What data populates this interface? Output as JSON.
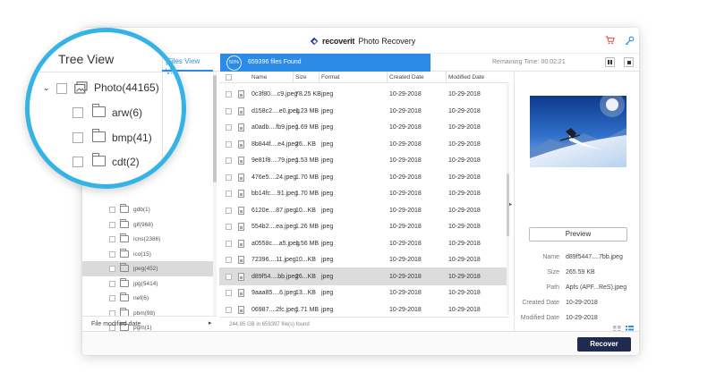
{
  "app": {
    "brand": "recoverit",
    "title": "Photo Recovery",
    "colors": {
      "accent": "#2b8be6",
      "ring": "#34b4e6",
      "recover_bg": "#1e2b4f"
    }
  },
  "toolbar": {
    "files_view_tab": "Files View",
    "progress_percent": "50%",
    "files_found": "659396 files Found",
    "remaining_time": "Remaining Time: 00:02:21"
  },
  "tree": {
    "title": "Tree View",
    "root": {
      "label": "Photo(44165)"
    },
    "magnified_items": [
      {
        "label": "arw(6)"
      },
      {
        "label": "bmp(41)"
      },
      {
        "label": "cdt(2)"
      }
    ],
    "items": [
      {
        "label": "gdb(1)",
        "selected": false
      },
      {
        "label": "gif(968)",
        "selected": false
      },
      {
        "label": "icns(2386)",
        "selected": false
      },
      {
        "label": "ico(15)",
        "selected": false
      },
      {
        "label": "jpeg(452)",
        "selected": true
      },
      {
        "label": "jpg(5414)",
        "selected": false
      },
      {
        "label": "nef(6)",
        "selected": false
      },
      {
        "label": "pbm(98)",
        "selected": false
      },
      {
        "label": "pgm(1)",
        "selected": false
      }
    ],
    "footer": "File modified date"
  },
  "table": {
    "columns": [
      "Name",
      "Size",
      "Format",
      "Created Date",
      "Modified Date"
    ],
    "rows": [
      {
        "name": "0c3f80....c9.jpeg",
        "size": "78.25 KB",
        "format": "jpeg",
        "created": "10-29-2018",
        "modified": "10-29-2018",
        "selected": false
      },
      {
        "name": "d158c2....e0.jpeg",
        "size": "1.23 MB",
        "format": "jpeg",
        "created": "10-29-2018",
        "modified": "10-29-2018",
        "selected": false
      },
      {
        "name": "a0adb....fb9.jpeg",
        "size": "1.69 MB",
        "format": "jpeg",
        "created": "10-29-2018",
        "modified": "10-29-2018",
        "selected": false
      },
      {
        "name": "8b844f....e4.jpeg",
        "size": "26...KB",
        "format": "jpeg",
        "created": "10-29-2018",
        "modified": "10-29-2018",
        "selected": false
      },
      {
        "name": "9e81f8....79.jpeg",
        "size": "1.53 MB",
        "format": "jpeg",
        "created": "10-29-2018",
        "modified": "10-29-2018",
        "selected": false
      },
      {
        "name": "476e5....24.jpeg",
        "size": "1.70 MB",
        "format": "jpeg",
        "created": "10-29-2018",
        "modified": "10-29-2018",
        "selected": false
      },
      {
        "name": "bb14fc....91.jpeg",
        "size": "1.70 MB",
        "format": "jpeg",
        "created": "10-29-2018",
        "modified": "10-29-2018",
        "selected": false
      },
      {
        "name": "6120e....87.jpeg",
        "size": "10...KB",
        "format": "jpeg",
        "created": "10-29-2018",
        "modified": "10-29-2018",
        "selected": false
      },
      {
        "name": "554b2....ea.jpeg",
        "size": "1.26 MB",
        "format": "jpeg",
        "created": "10-29-2018",
        "modified": "10-29-2018",
        "selected": false
      },
      {
        "name": "a0558c....a5.jpeg",
        "size": "1.56 MB",
        "format": "jpeg",
        "created": "10-29-2018",
        "modified": "10-29-2018",
        "selected": false
      },
      {
        "name": "72396....11.jpeg",
        "size": "10...KB",
        "format": "jpeg",
        "created": "10-29-2018",
        "modified": "10-29-2018",
        "selected": false
      },
      {
        "name": "d89f54....bb.jpeg",
        "size": "26...KB",
        "format": "jpeg",
        "created": "10-29-2018",
        "modified": "10-29-2018",
        "selected": true
      },
      {
        "name": "9aaa85....6.jpeg",
        "size": "13...KB",
        "format": "jpeg",
        "created": "10-29-2018",
        "modified": "10-29-2018",
        "selected": false
      },
      {
        "name": "06987....2fc.jpeg",
        "size": "1.71 MB",
        "format": "jpeg",
        "created": "10-29-2018",
        "modified": "10-29-2018",
        "selected": false
      }
    ],
    "footer": "244.85 GB in 659397 file(s) found"
  },
  "preview": {
    "button": "Preview",
    "details": [
      {
        "key": "Name",
        "value": "d89f5447....7bb.jpeg"
      },
      {
        "key": "Size",
        "value": "265.59 KB"
      },
      {
        "key": "Path",
        "value": "Apfs (APF...ReS).jpeg"
      },
      {
        "key": "Created Date",
        "value": "10-29-2018"
      },
      {
        "key": "Modified Date",
        "value": "10-29-2018"
      }
    ]
  },
  "actions": {
    "recover": "Recover"
  }
}
